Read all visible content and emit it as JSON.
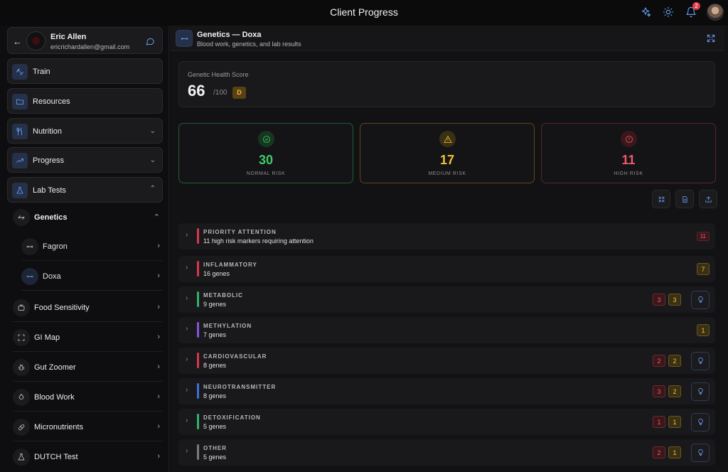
{
  "app": {
    "title": "Client Progress",
    "notification_count": "2"
  },
  "user": {
    "name": "Eric Allen",
    "email": "ericrichardallen@gmail.com"
  },
  "sidebar": {
    "items": [
      {
        "label": "Train",
        "icon": "dumbbell-icon"
      },
      {
        "label": "Resources",
        "icon": "folder-icon"
      },
      {
        "label": "Nutrition",
        "icon": "utensils-icon"
      },
      {
        "label": "Progress",
        "icon": "trending-up-icon"
      },
      {
        "label": "Lab Tests",
        "icon": "flask-icon"
      }
    ],
    "lab_tests": {
      "genetics": "Genetics",
      "genetics_children": [
        "Fagron",
        "Doxa"
      ],
      "others": [
        "Food Sensitivity",
        "GI Map",
        "Gut Zoomer",
        "Blood Work",
        "Micronutrients",
        "DUTCH Test"
      ]
    }
  },
  "main": {
    "title": "Genetics — Doxa",
    "subtitle": "Blood work, genetics, and lab results",
    "score": {
      "label": "Genetic Health Score",
      "value": "66",
      "max": "/100",
      "grade": "D"
    },
    "risks": {
      "normal": {
        "value": "30",
        "label": "NORMAL RISK"
      },
      "medium": {
        "value": "17",
        "label": "MEDIUM RISK"
      },
      "high": {
        "value": "11",
        "label": "HIGH RISK"
      }
    },
    "categories": [
      {
        "name": "PRIORITY ATTENTION",
        "desc": "11 high risk markers requiring attention",
        "bar": "#d8384b",
        "high": "11",
        "medium": ""
      },
      {
        "name": "INFLAMMATORY",
        "desc": "16 genes",
        "bar": "#d8384b",
        "high": "",
        "medium": "7"
      },
      {
        "name": "METABOLIC",
        "desc": "9 genes",
        "bar": "#2fb36a",
        "high": "3",
        "medium": "3"
      },
      {
        "name": "METHYLATION",
        "desc": "7 genes",
        "bar": "#8b4fe0",
        "high": "",
        "medium": "1"
      },
      {
        "name": "CARDIOVASCULAR",
        "desc": "8 genes",
        "bar": "#d8384b",
        "high": "2",
        "medium": "2"
      },
      {
        "name": "NEUROTRANSMITTER",
        "desc": "8 genes",
        "bar": "#3a6fe0",
        "high": "3",
        "medium": "2"
      },
      {
        "name": "DETOXIFICATION",
        "desc": "5 genes",
        "bar": "#2fb36a",
        "high": "1",
        "medium": "1"
      },
      {
        "name": "OTHER",
        "desc": "5 genes",
        "bar": "#7a7a80",
        "high": "2",
        "medium": "1"
      }
    ]
  },
  "colors": {
    "accent": "#6aa6ff",
    "normal": "#3ecb6a",
    "medium": "#f1c233",
    "high": "#f0596a"
  }
}
